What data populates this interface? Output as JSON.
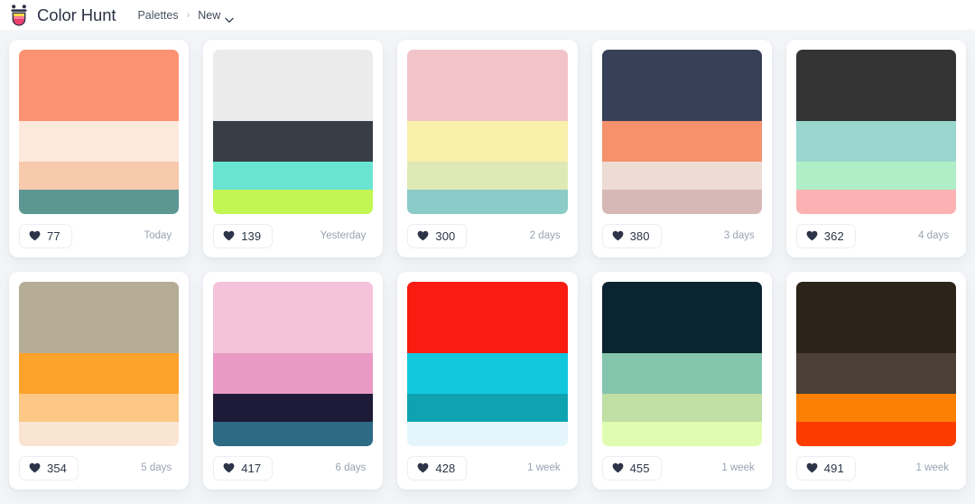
{
  "header": {
    "brand_name": "Color Hunt",
    "logo_icon": "color-hunt-cup-logo",
    "breadcrumb": {
      "root": "Palettes",
      "separator": "›",
      "current": "New",
      "chevron_icon": "chevron-down-icon"
    }
  },
  "card_meta": {
    "heart_icon": "heart-icon",
    "heart_color": "#2d3448"
  },
  "theme": {
    "page_background": "#f3f5f8",
    "header_background": "#ffffff",
    "card_background": "#ffffff",
    "text_primary": "#2c3245",
    "text_muted": "#9aa3b2"
  },
  "palettes": [
    {
      "likes": "77",
      "age": "Today",
      "colors": [
        "#fd9272",
        "#fde9dc",
        "#f7c9ad",
        "#5d9792"
      ]
    },
    {
      "likes": "139",
      "age": "Yesterday",
      "colors": [
        "#ebebeb",
        "#393e46",
        "#6ae4d2",
        "#c1f653"
      ]
    },
    {
      "likes": "300",
      "age": "2 days",
      "colors": [
        "#f2c4c9",
        "#f8efa9",
        "#dfe9b6",
        "#8bcbc8"
      ]
    },
    {
      "likes": "380",
      "age": "3 days",
      "colors": [
        "#374056",
        "#f5916c",
        "#eddcd4",
        "#d6b8b4"
      ]
    },
    {
      "likes": "362",
      "age": "4 days",
      "colors": [
        "#343434",
        "#98d6ce",
        "#b0eec8",
        "#fcb2b2"
      ]
    },
    {
      "likes": "354",
      "age": "5 days",
      "colors": [
        "#b6ad96",
        "#fda22b",
        "#fdc786",
        "#fae5d3"
      ]
    },
    {
      "likes": "417",
      "age": "6 days",
      "colors": [
        "#f4c2da",
        "#e99ac4",
        "#1e1b38",
        "#2d6b85"
      ]
    },
    {
      "likes": "428",
      "age": "1 week",
      "colors": [
        "#fa1b11",
        "#13c7dd",
        "#0fa3b1",
        "#e4f6fc"
      ]
    },
    {
      "likes": "455",
      "age": "1 week",
      "colors": [
        "#0b2431",
        "#84c5ad",
        "#bfdfa5",
        "#dffcb1"
      ]
    },
    {
      "likes": "491",
      "age": "1 week",
      "colors": [
        "#2c241a",
        "#4a4035",
        "#fa8003",
        "#fb3c01"
      ]
    }
  ]
}
